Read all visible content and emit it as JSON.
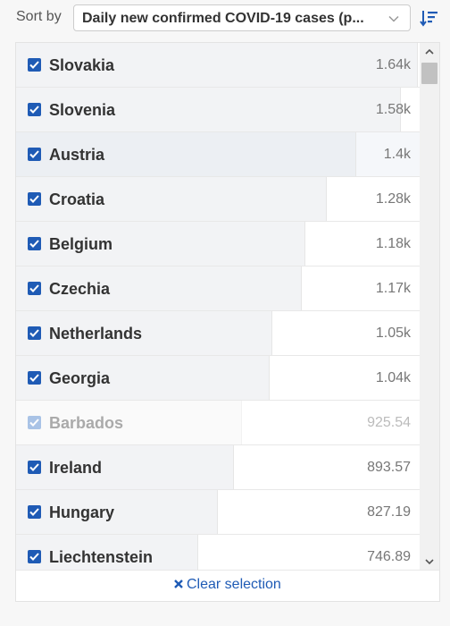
{
  "sort": {
    "label": "Sort by",
    "selected": "Daily new confirmed COVID-19 cases (p..."
  },
  "entities": [
    {
      "name": "Slovakia",
      "value": "1.64k",
      "fraction": 0.99,
      "selected": true,
      "faded": false,
      "hover": false
    },
    {
      "name": "Slovenia",
      "value": "1.58k",
      "fraction": 0.947,
      "selected": true,
      "faded": false,
      "hover": false
    },
    {
      "name": "Austria",
      "value": "1.4k",
      "fraction": 0.838,
      "selected": true,
      "faded": false,
      "hover": true
    },
    {
      "name": "Croatia",
      "value": "1.28k",
      "fraction": 0.764,
      "selected": true,
      "faded": false,
      "hover": false
    },
    {
      "name": "Belgium",
      "value": "1.18k",
      "fraction": 0.711,
      "selected": true,
      "faded": false,
      "hover": false
    },
    {
      "name": "Czechia",
      "value": "1.17k",
      "fraction": 0.702,
      "selected": true,
      "faded": false,
      "hover": false
    },
    {
      "name": "Netherlands",
      "value": "1.05k",
      "fraction": 0.631,
      "selected": true,
      "faded": false,
      "hover": false
    },
    {
      "name": "Georgia",
      "value": "1.04k",
      "fraction": 0.624,
      "selected": true,
      "faded": false,
      "hover": false
    },
    {
      "name": "Barbados",
      "value": "925.54",
      "fraction": 0.555,
      "selected": true,
      "faded": true,
      "hover": false
    },
    {
      "name": "Ireland",
      "value": "893.57",
      "fraction": 0.535,
      "selected": true,
      "faded": false,
      "hover": false
    },
    {
      "name": "Hungary",
      "value": "827.19",
      "fraction": 0.495,
      "selected": true,
      "faded": false,
      "hover": false
    },
    {
      "name": "Liechtenstein",
      "value": "746.89",
      "fraction": 0.447,
      "selected": true,
      "faded": false,
      "hover": false
    }
  ],
  "footer": {
    "clear_label": "Clear selection"
  }
}
